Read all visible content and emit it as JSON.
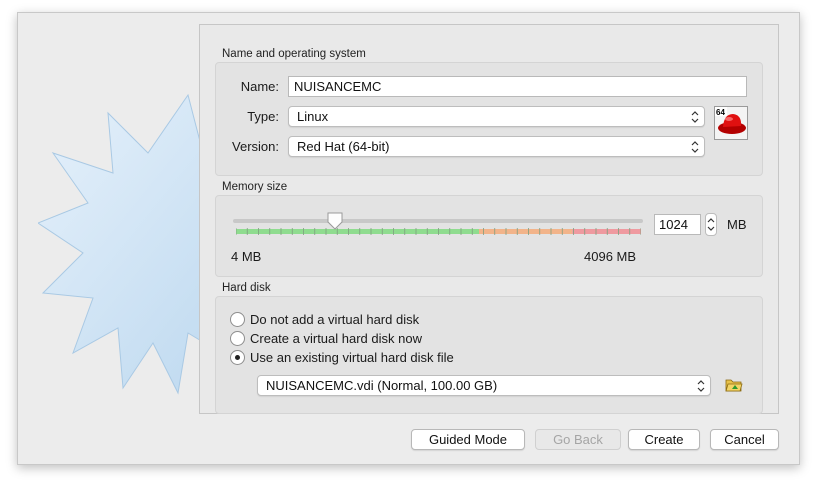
{
  "name_os": {
    "title": "Name and operating system",
    "name_label": "Name:",
    "name_value": "NUISANCEMC",
    "type_label": "Type:",
    "type_value": "Linux",
    "version_label": "Version:",
    "version_value": "Red Hat (64-bit)",
    "os_icon": "redhat-64-icon",
    "os_icon_badge": "64"
  },
  "memory": {
    "title": "Memory size",
    "value": "1024",
    "unit": "MB",
    "min_label": "4 MB",
    "max_label": "4096 MB",
    "min_mb": 4,
    "max_mb": 4096,
    "current_mb": 1024
  },
  "hard_disk": {
    "title": "Hard disk",
    "options": [
      {
        "label": "Do not add a virtual hard disk",
        "checked": false
      },
      {
        "label": "Create a virtual hard disk now",
        "checked": false
      },
      {
        "label": "Use an existing virtual hard disk file",
        "checked": true
      }
    ],
    "file_value": "NUISANCEMC.vdi (Normal, 100.00 GB)",
    "folder_icon": "folder-open-icon"
  },
  "buttons": {
    "guided": "Guided Mode",
    "back": "Go Back",
    "create": "Create",
    "cancel": "Cancel"
  },
  "colors": {
    "green_zone": "#8fdc8f",
    "orange_zone": "#f2b48a",
    "red_zone": "#ef9aa0",
    "wizard_blue": "#cfe4f5"
  }
}
